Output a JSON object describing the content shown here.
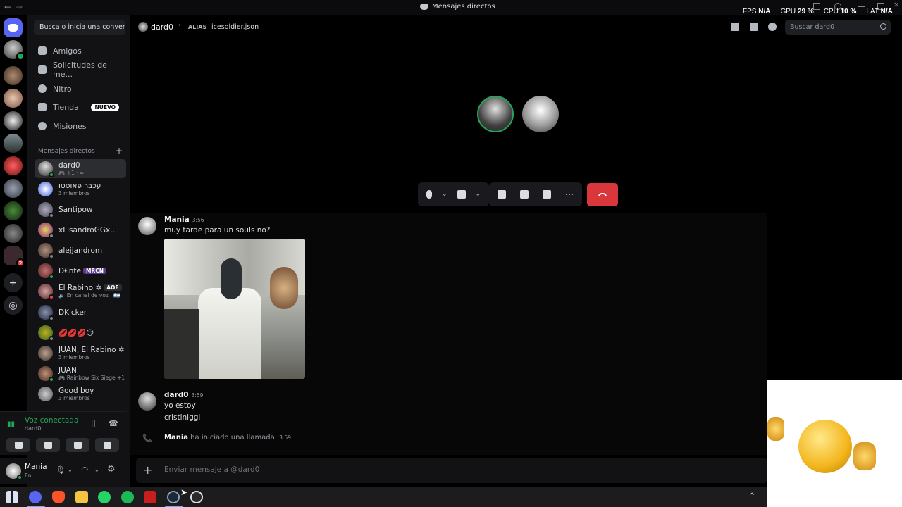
{
  "window": {
    "title": "Mensajes directos",
    "stats": [
      {
        "label": "FPS",
        "value": "N/A"
      },
      {
        "label": "GPU",
        "value": "29 %"
      },
      {
        "label": "CPU",
        "value": "10 %"
      },
      {
        "label": "LAT",
        "value": "N/A"
      }
    ]
  },
  "sidebar": {
    "search_label": "Busca o inicia una convers...",
    "nav": [
      {
        "label": "Amigos",
        "icon": "friends-icon"
      },
      {
        "label": "Solicitudes de me...",
        "icon": "message-requests-icon"
      },
      {
        "label": "Nitro",
        "icon": "nitro-icon"
      },
      {
        "label": "Tienda",
        "icon": "shop-icon",
        "badge": "NUEVO"
      },
      {
        "label": "Misiones",
        "icon": "quests-icon"
      }
    ],
    "dm_header": "Mensajes directos",
    "dms": [
      {
        "name": "dard0",
        "sub": "🎮 +1 · ≈"
      },
      {
        "name": "עכבר פאוסטו",
        "sub": "3 miembros"
      },
      {
        "name": "Santipow",
        "sub": ""
      },
      {
        "name": "xLisandroGGx...",
        "sub": ""
      },
      {
        "name": "alejjandrom",
        "sub": ""
      },
      {
        "name": "D€nte",
        "tag": "MRCN",
        "sub": ""
      },
      {
        "name": "El Rabino ✡",
        "tag": "AOE",
        "sub": "🔈 En canal de voz · 🇦🇷"
      },
      {
        "name": "DKicker",
        "sub": ""
      },
      {
        "name": "💋💋💋😏",
        "sub": ""
      },
      {
        "name": "JUAN, El Rabino ✡",
        "sub": "3 miembros"
      },
      {
        "name": "JUAN",
        "sub": "🎮 Rainbow Six Siege +1"
      },
      {
        "name": "Good boy",
        "sub": "3 miembros"
      }
    ],
    "voice": {
      "title": "Voz conectada",
      "sub": "dard0"
    },
    "user": {
      "name": "Mania",
      "status": "En ..."
    }
  },
  "chat": {
    "recipient": "dard0",
    "alias_label": "ALIAS",
    "alias_value": "icesoldier.json",
    "search_placeholder": "Buscar dard0",
    "messages": [
      {
        "author": "Mania",
        "time": "3:56",
        "lines": [
          "muy tarde para un souls no?"
        ]
      },
      {
        "author": "dard0",
        "time": "3:59",
        "lines": [
          "yo estoy",
          "cristiniggi"
        ]
      }
    ],
    "system": {
      "author": "Mania",
      "text": "ha iniciado una llamada.",
      "time": "3:59"
    },
    "composer_placeholder": "Enviar mensaje a @dard0"
  },
  "colors": {
    "brand": "#5865f2",
    "online": "#23a55a",
    "danger": "#da373c"
  }
}
